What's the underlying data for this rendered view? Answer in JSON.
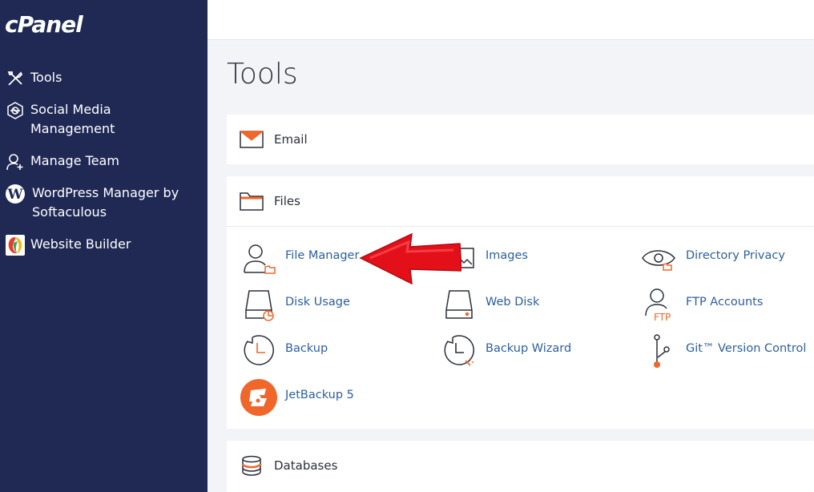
{
  "brand": {
    "logo_text": "cPanel"
  },
  "sidebar": {
    "items": [
      {
        "label": "Tools",
        "icon": "tools-icon"
      },
      {
        "label": "Social Media Management",
        "icon": "social-media-icon"
      },
      {
        "label": "Manage Team",
        "icon": "manage-team-icon"
      },
      {
        "label": "WordPress Manager by Softaculous",
        "icon": "wordpress-icon"
      },
      {
        "label": "Website Builder",
        "icon": "website-builder-icon"
      }
    ]
  },
  "page": {
    "title": "Tools"
  },
  "sections": {
    "email": {
      "label": "Email",
      "icon": "envelope-icon"
    },
    "files": {
      "label": "Files",
      "icon": "folder-icon",
      "tools": [
        {
          "label": "File Manager",
          "icon": "file-manager-icon"
        },
        {
          "label": "Images",
          "icon": "images-icon"
        },
        {
          "label": "Directory Privacy",
          "icon": "eye-icon"
        },
        {
          "label": "Disk Usage",
          "icon": "disk-usage-icon"
        },
        {
          "label": "Web Disk",
          "icon": "web-disk-icon"
        },
        {
          "label": "FTP Accounts",
          "icon": "ftp-accounts-icon",
          "badge": "FTP"
        },
        {
          "label": "Backup",
          "icon": "backup-icon"
        },
        {
          "label": "Backup Wizard",
          "icon": "backup-wizard-icon"
        },
        {
          "label": "Git™ Version Control",
          "icon": "git-icon"
        },
        {
          "label": "JetBackup 5",
          "icon": "jetbackup-icon"
        }
      ]
    },
    "databases": {
      "label": "Databases",
      "icon": "database-icon"
    }
  },
  "colors": {
    "sidebar_bg": "#1f2954",
    "accent_orange": "#f1662a",
    "link_blue": "#2c5f9c",
    "arrow_red": "#e3101a"
  }
}
